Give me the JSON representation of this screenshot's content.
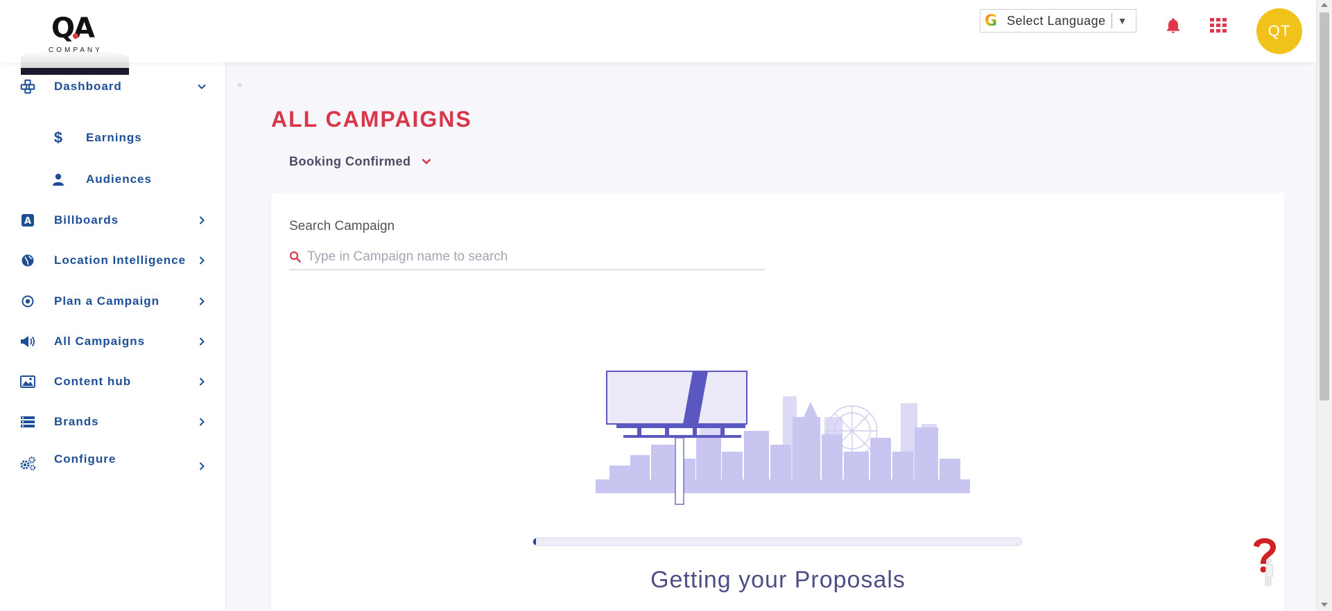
{
  "header": {
    "logo_text": "QA",
    "logo_subtext": "COMPANY",
    "language_label": "Select Language",
    "language_arrow": "▼",
    "google_icon": "G",
    "avatar_initials": "QT",
    "avatar_color": "#f1c31a",
    "accent_color": "#e0384a"
  },
  "sidebar": {
    "items": [
      {
        "label": "Dashboard",
        "icon": "dashboard-icon",
        "chevron": "down"
      },
      {
        "label": "Earnings",
        "icon": "dollar-icon",
        "sub": true
      },
      {
        "label": "Audiences",
        "icon": "user-icon",
        "sub": true
      },
      {
        "label": "Billboards",
        "icon": "billboard-icon",
        "chevron": "right"
      },
      {
        "label": "Location Intelligence",
        "icon": "globe-icon",
        "chevron": "right"
      },
      {
        "label": "Plan a Campaign",
        "icon": "target-icon",
        "chevron": "right"
      },
      {
        "label": "All Campaigns",
        "icon": "megaphone-icon",
        "chevron": "right"
      },
      {
        "label": "Content hub",
        "icon": "image-icon",
        "chevron": "right"
      },
      {
        "label": "Brands",
        "icon": "brands-icon",
        "chevron": "right"
      },
      {
        "label": "Configure",
        "icon": "gears-icon",
        "chevron": "right"
      }
    ]
  },
  "main": {
    "page_title": "ALL CAMPAIGNS",
    "filter_label": "Booking Confirmed",
    "search": {
      "label": "Search Campaign",
      "placeholder": "Type in Campaign name to search",
      "value": ""
    },
    "loading": {
      "text": "Getting your Proposals",
      "progress_percent": 0.5
    }
  },
  "colors": {
    "title_red": "#d8374a",
    "nav_blue": "#1e4e96",
    "illustration_purple": "#c8c6f0"
  }
}
